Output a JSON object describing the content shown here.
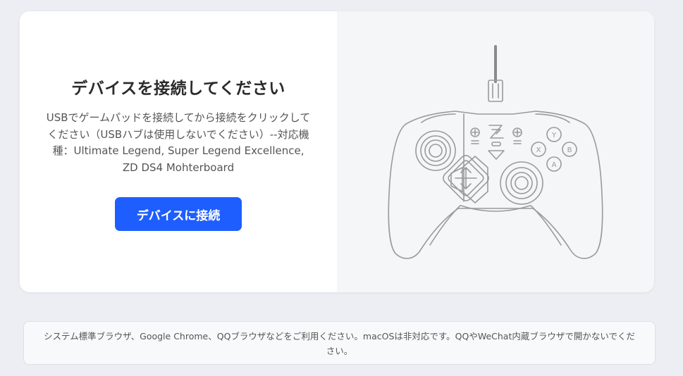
{
  "connect_panel": {
    "title": "デバイスを接続してください",
    "description": "USBでゲームパッドを接続してから接続をクリックしてください（USBハブは使用しないでください）--対応機種：Ultimate Legend, Super Legend Excellence, ZD DS4 Mohterboard",
    "connect_button_label": "デバイスに接続"
  },
  "controller": {
    "face_buttons": [
      "Y",
      "X",
      "B",
      "A"
    ]
  },
  "footer_note": "システム標準ブラウザ、Google Chrome、QQブラウザなどをご利用ください。macOSは非対応です。QQやWeChat内蔵ブラウザで開かないでください。",
  "colors": {
    "accent": "#1f5efe",
    "page_background": "#eceef3",
    "illustration_background": "#f5f6f8"
  }
}
